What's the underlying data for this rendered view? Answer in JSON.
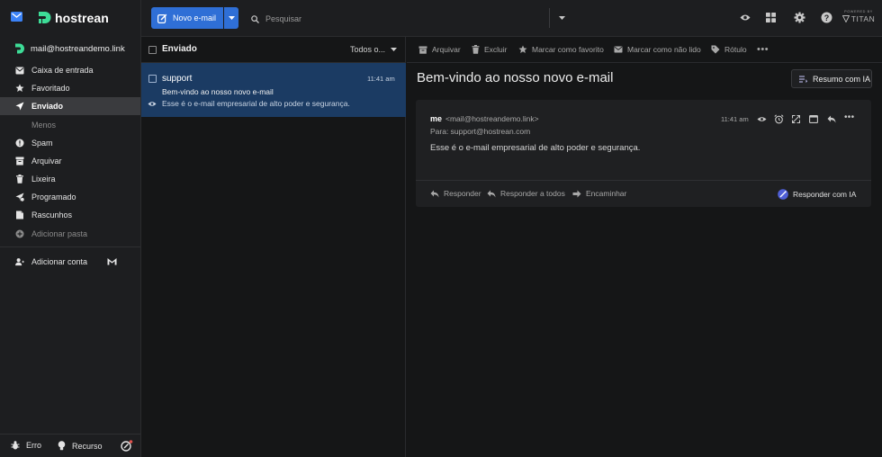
{
  "brand": {
    "name": "hostrean",
    "powered_by": "POWERED BY",
    "titan": "TITAN"
  },
  "account": {
    "email": "mail@hostreandemo.link"
  },
  "sidebar": {
    "items": [
      {
        "label": "Caixa de entrada",
        "icon": "inbox-icon"
      },
      {
        "label": "Favoritado",
        "icon": "star-icon"
      },
      {
        "label": "Enviado",
        "icon": "send-icon",
        "active": true
      },
      {
        "label": "Menos",
        "icon": ""
      },
      {
        "label": "Spam",
        "icon": "spam-icon"
      },
      {
        "label": "Arquivar",
        "icon": "archive-icon"
      },
      {
        "label": "Lixeira",
        "icon": "trash-icon"
      },
      {
        "label": "Programado",
        "icon": "scheduled-icon"
      },
      {
        "label": "Rascunhos",
        "icon": "drafts-icon"
      },
      {
        "label": "Adicionar pasta",
        "icon": "add-folder-icon"
      }
    ],
    "add_account": "Adicionar conta",
    "footer": {
      "error": "Erro",
      "feature": "Recurso"
    }
  },
  "topbar": {
    "compose_label": "Novo e-mail",
    "search_placeholder": "Pesquisar"
  },
  "list": {
    "folder_title": "Enviado",
    "filter_label": "Todos o...",
    "messages": [
      {
        "from": "support",
        "time": "11:41 am",
        "subject": "Bem-vindo ao nosso novo e-mail",
        "preview": "Esse é o e-mail empresarial de alto poder e segurança."
      }
    ]
  },
  "reader": {
    "toolbar": {
      "archive": "Arquivar",
      "delete": "Excluir",
      "mark_favorite": "Marcar como favorito",
      "mark_unread": "Marcar como não lido",
      "label": "Rótulo"
    },
    "subject": "Bem-vindo ao nosso novo e-mail",
    "ai_summary": "Resumo com IA",
    "message": {
      "sender_name": "me",
      "sender_email": "<mail@hostreandemo.link>",
      "to": "Para: support@hostrean.com",
      "time": "11:41 am",
      "body": "Esse é o e-mail empresarial de alto poder e segurança."
    },
    "actions": {
      "reply": "Responder",
      "reply_all": "Responder a todos",
      "forward": "Encaminhar",
      "reply_ai": "Responder com IA"
    }
  },
  "colors": {
    "accent": "#2f6fd6",
    "brand_green": "#3ddc97",
    "selected_row": "#1b3b63",
    "background": "#151617"
  }
}
